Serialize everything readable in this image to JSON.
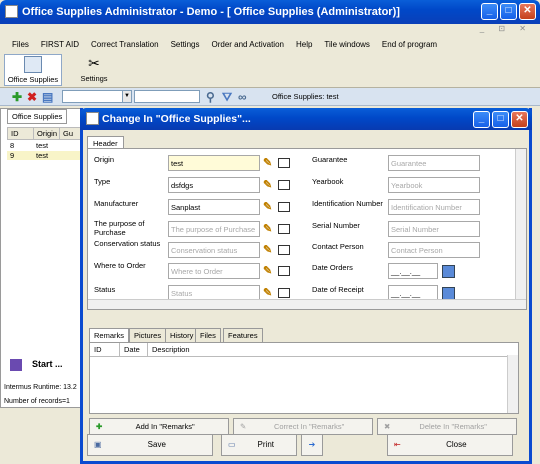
{
  "main": {
    "title": "Office Supplies  Administrator - Demo - [       Office Supplies (Administrator)]"
  },
  "menu": [
    "Files",
    "FIRST AID",
    "Correct Translation",
    "Settings",
    "Order and Activation",
    "Help",
    "Tile windows",
    "End of program"
  ],
  "mdi_controls": "_ ⊡ ✕",
  "ribbon": {
    "office_supplies": "Office Supplies",
    "settings": "Settings"
  },
  "toolbar": {
    "status": "Office Supplies: test"
  },
  "left": {
    "tab": "Office Supplies",
    "headers": [
      "ID",
      "Origin",
      "Gu"
    ],
    "rows": [
      [
        "8",
        "test"
      ],
      [
        "9",
        "test"
      ]
    ],
    "start": "Start ...",
    "runtime": "Intermus Runtime: 13.2",
    "records": "Number of records=1"
  },
  "dialog": {
    "title": "Change  In \"Office Supplies\"...",
    "header_tab": "Header",
    "left_fields": [
      {
        "label": "Origin",
        "value": "test"
      },
      {
        "label": "Type",
        "value": "dsfdgs"
      },
      {
        "label": "Manufacturer",
        "value": "Sanplast"
      },
      {
        "label": "The purpose of Purchase",
        "value": "The purpose of Purchase"
      },
      {
        "label": "Conservation status",
        "value": "Conservation status"
      },
      {
        "label": "Where to Order",
        "value": "Where to Order"
      },
      {
        "label": "Status",
        "value": "Status"
      }
    ],
    "right_fields": [
      {
        "label": "Guarantee",
        "value": "Guarantee"
      },
      {
        "label": "Yearbook",
        "value": "Yearbook"
      },
      {
        "label": "Identification Number",
        "value": "Identification Number"
      },
      {
        "label": "Serial Number",
        "value": "Serial Number"
      },
      {
        "label": "Contact Person",
        "value": "Contact Person"
      },
      {
        "label": "Date Orders",
        "value": "__.__.__"
      },
      {
        "label": "Date of Receipt",
        "value": "__.__.__"
      }
    ],
    "lower_tabs": [
      "Remarks",
      "Pictures",
      "History",
      "Files",
      "Features"
    ],
    "grid_headers": [
      "ID",
      "Date",
      "Description"
    ],
    "add": "Add  In \"Remarks\"",
    "correct": "Correct  In \"Remarks\"",
    "delete": "Delete  In \"Remarks\"",
    "save": "Save",
    "print": "Print",
    "close": "Close"
  }
}
